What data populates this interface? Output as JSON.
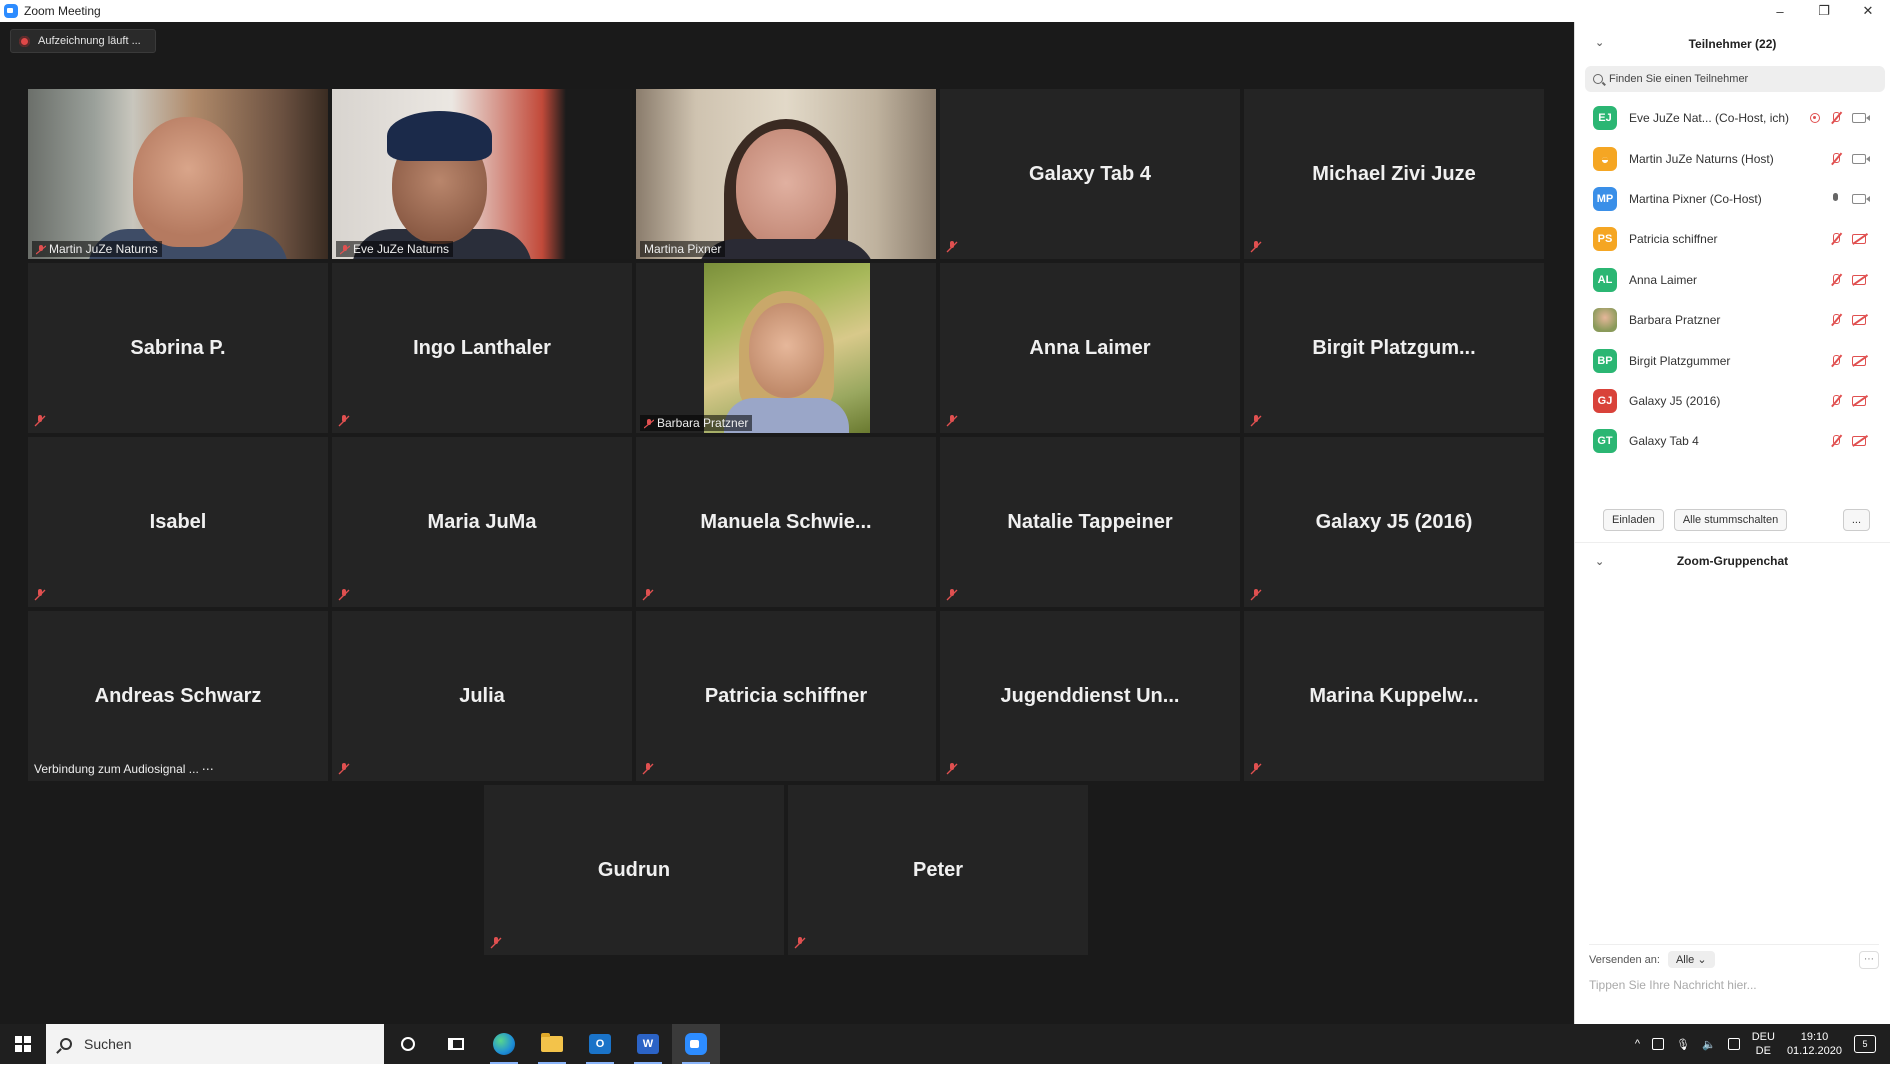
{
  "window": {
    "title": "Zoom Meeting",
    "minimize": "–",
    "restore": "❐",
    "close": "✕"
  },
  "recording": {
    "label": "Aufzeichnung läuft ..."
  },
  "tiles": {
    "t1": {
      "label": "Martin JuZe Naturns"
    },
    "t2": {
      "label": "Eve JuZe Naturns"
    },
    "t3": {
      "label": "Martina Pixner"
    },
    "t4": {
      "name": "Galaxy Tab 4"
    },
    "t5": {
      "name": "Michael Zivi Juze"
    },
    "t6": {
      "name": "Sabrina P."
    },
    "t7": {
      "name": "Ingo Lanthaler"
    },
    "t8": {
      "label": "Barbara Pratzner"
    },
    "t9": {
      "name": "Anna Laimer"
    },
    "t10": {
      "name": "Birgit Platzgum..."
    },
    "t11": {
      "name": "Isabel"
    },
    "t12": {
      "name": "Maria JuMa"
    },
    "t13": {
      "name": "Manuela Schwie..."
    },
    "t14": {
      "name": "Natalie Tappeiner"
    },
    "t15": {
      "name": "Galaxy J5 (2016)"
    },
    "t16": {
      "name": "Andreas Schwarz",
      "status": "Verbindung zum Audiosignal ...",
      "status_dots": "⋯"
    },
    "t17": {
      "name": "Julia"
    },
    "t18": {
      "name": "Patricia schiffner"
    },
    "t19": {
      "name": "Jugenddienst Un..."
    },
    "t20": {
      "name": "Marina Kuppelw..."
    },
    "t21": {
      "name": "Gudrun"
    },
    "t22": {
      "name": "Peter"
    }
  },
  "panel": {
    "title": "Teilnehmer (22)",
    "collapse": "⌄",
    "search_placeholder": "Finden Sie einen Teilnehmer",
    "participants": [
      {
        "initials": "EJ",
        "name": "Eve JuZe Nat...  (Co-Host, ich)",
        "color": "#2bb673"
      },
      {
        "initials": "",
        "name": "Martin JuZe Naturns (Host)",
        "color": "#f5a623"
      },
      {
        "initials": "MP",
        "name": "Martina Pixner (Co-Host)",
        "color": "#3a8fe8"
      },
      {
        "initials": "PS",
        "name": "Patricia schiffner",
        "color": "#f5a623"
      },
      {
        "initials": "AL",
        "name": "Anna Laimer",
        "color": "#2bb673"
      },
      {
        "initials": "",
        "name": "Barbara Pratzner",
        "color": "#8a9a5a"
      },
      {
        "initials": "BP",
        "name": "Birgit Platzgummer",
        "color": "#2bb673"
      },
      {
        "initials": "GJ",
        "name": "Galaxy J5 (2016)",
        "color": "#d9423a"
      },
      {
        "initials": "GT",
        "name": "Galaxy Tab 4",
        "color": "#2bb673"
      }
    ],
    "invite": "Einladen",
    "mute_all": "Alle stummschalten",
    "more": "..."
  },
  "chat": {
    "title": "Zoom-Gruppenchat",
    "collapse": "⌄",
    "send_to_label": "Versenden an:",
    "send_to_value": "Alle",
    "send_more": "⋯",
    "input_placeholder": "Tippen Sie Ihre Nachricht hier..."
  },
  "taskbar": {
    "search_label": "Suchen",
    "outlook": "O",
    "word": "W",
    "lang_top": "DEU",
    "lang_bottom": "DE",
    "time": "19:10",
    "date": "01.12.2020",
    "notif_count": "5"
  }
}
